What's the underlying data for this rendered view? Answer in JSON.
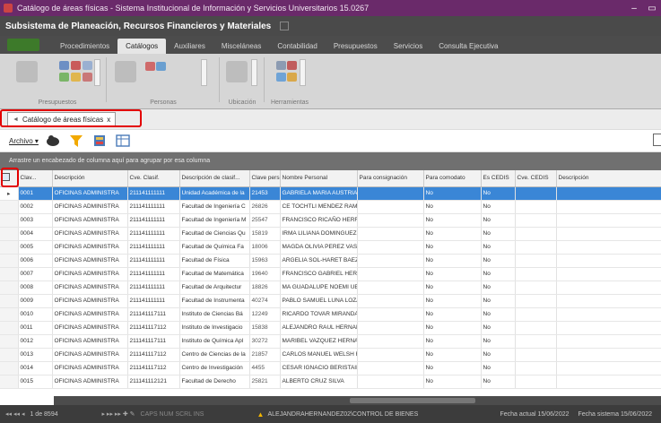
{
  "window": {
    "title": "Catálogo de áreas físicas - Sistema Institucional de Información y Servicios Universitarios 15.0267",
    "min_glyph": "–",
    "max_glyph": "▭"
  },
  "subsystem": {
    "title": "Subsistema de Planeación, Recursos Financieros y Materiales"
  },
  "menu": {
    "tabs": [
      "Procedimientos",
      "Catálogos",
      "Auxiliares",
      "Misceláneas",
      "Contabilidad",
      "Presupuestos",
      "Servicios",
      "Consulta Ejecutiva"
    ],
    "active": "Catálogos"
  },
  "ribbon": {
    "groups": [
      "Presupuestos",
      "Personas",
      "Ubicación",
      "Herramientas"
    ]
  },
  "doc_tab": {
    "label": "Catálogo de áreas físicas",
    "close": "x"
  },
  "toolbar": {
    "archivo": "Archivo ▾"
  },
  "groupbar": {
    "text": "Arrastre un encabezado de columna aquí para agrupar por esa columna"
  },
  "grid": {
    "columns": [
      "Clav...",
      "Descripción",
      "Cve. Clasif.",
      "Descripción de clasif...",
      "Clave pers.",
      "Nombre Personal",
      "Para consignación",
      "Para comodato",
      "Es CEDIS",
      "Cve. CEDIS",
      "Descripción"
    ],
    "rows": [
      [
        "0001",
        "OFICINAS ADMINISTRA",
        "211141111111",
        "Unidad Académica de la",
        "21453",
        "GABRIELA MARIA AUSTRIA P",
        "",
        "No",
        "No",
        "",
        ""
      ],
      [
        "0002",
        "OFICINAS ADMINISTRA",
        "211141111111",
        "Facultad de Ingeniería C",
        "26826",
        "CE TOCHTLI MENDEZ RAMIRE",
        "",
        "No",
        "No",
        "",
        ""
      ],
      [
        "0003",
        "OFICINAS ADMINISTRA",
        "211141111111",
        "Facultad de Ingeniería M",
        "25547",
        "FRANCISCO RICAÑO HERRER",
        "",
        "No",
        "No",
        "",
        ""
      ],
      [
        "0004",
        "OFICINAS ADMINISTRA",
        "211141111111",
        "Facultad de Ciencias Qu",
        "15819",
        "IRMA LILIANA DOMINGUEZ C/",
        "",
        "No",
        "No",
        "",
        ""
      ],
      [
        "0005",
        "OFICINAS ADMINISTRA",
        "211141111111",
        "Facultad de Química Fa",
        "18006",
        "MAGDA OLIVIA PEREZ VASQ",
        "",
        "No",
        "No",
        "",
        ""
      ],
      [
        "0006",
        "OFICINAS ADMINISTRA",
        "211141111111",
        "Facultad de Física",
        "15963",
        "ARGELIA SOL-HARET BAEZ I",
        "",
        "No",
        "No",
        "",
        ""
      ],
      [
        "0007",
        "OFICINAS ADMINISTRA",
        "211141111111",
        "Facultad de Matemática",
        "19640",
        "FRANCISCO GABRIEL HERNA",
        "",
        "No",
        "No",
        "",
        ""
      ],
      [
        "0008",
        "OFICINAS ADMINISTRA",
        "211141111111",
        "Facultad de Arquitectur",
        "18826",
        "MA GUADALUPE NOEMI UEH/",
        "",
        "No",
        "No",
        "",
        ""
      ],
      [
        "0009",
        "OFICINAS ADMINISTRA",
        "211141111111",
        "Facultad de Instrumenta",
        "40274",
        "PABLO SAMUEL LUNA LOZA",
        "",
        "No",
        "No",
        "",
        ""
      ],
      [
        "0010",
        "OFICINAS ADMINISTRA",
        "211141117111",
        "Instituto de Ciencias Bá",
        "12249",
        "RICARDO TOVAR MIRANDA",
        "",
        "No",
        "No",
        "",
        ""
      ],
      [
        "0011",
        "OFICINAS ADMINISTRA",
        "211141117112",
        "Instituto de Investigacio",
        "15838",
        "ALEJANDRO RAUL HERNAND",
        "",
        "No",
        "No",
        "",
        ""
      ],
      [
        "0012",
        "OFICINAS ADMINISTRA",
        "211141117111",
        "Instituto de Química Apl",
        "30272",
        "MARIBEL VAZQUEZ HERNAN",
        "",
        "No",
        "No",
        "",
        ""
      ],
      [
        "0013",
        "OFICINAS ADMINISTRA",
        "211141117112",
        "Centro de Ciencias de la",
        "21857",
        "CARLOS MANUEL WELSH RO",
        "",
        "No",
        "No",
        "",
        ""
      ],
      [
        "0014",
        "OFICINAS ADMINISTRA",
        "211141117112",
        "Centro de Investigación",
        "4455",
        "CESAR IGNACIO BERISTAIN C",
        "",
        "No",
        "No",
        "",
        ""
      ],
      [
        "0015",
        "OFICINAS ADMINISTRA",
        "211141112121",
        "Facultad de Derecho",
        "25821",
        "ALBERTO CRUZ SILVA",
        "",
        "No",
        "No",
        "",
        ""
      ]
    ]
  },
  "status": {
    "nav": "◂◂ ◂◂ ◂",
    "record": "1 de 8594",
    "nav_next": "▸ ▸▸ ▸▸ ✚ ✎",
    "keys": "CAPS  NUM  SCRL  INS",
    "user": "ALEJANDRAHERNANDEZ02\\CONTROL DE BIENES",
    "fecha_actual": "Fecha actual 15/06/2022",
    "fecha_sistema": "Fecha sistema 15/06/2022"
  },
  "colors": {
    "title_bg": "#6a2a6a",
    "selected_row": "#3a86d6",
    "highlight_box": "#e30000"
  }
}
